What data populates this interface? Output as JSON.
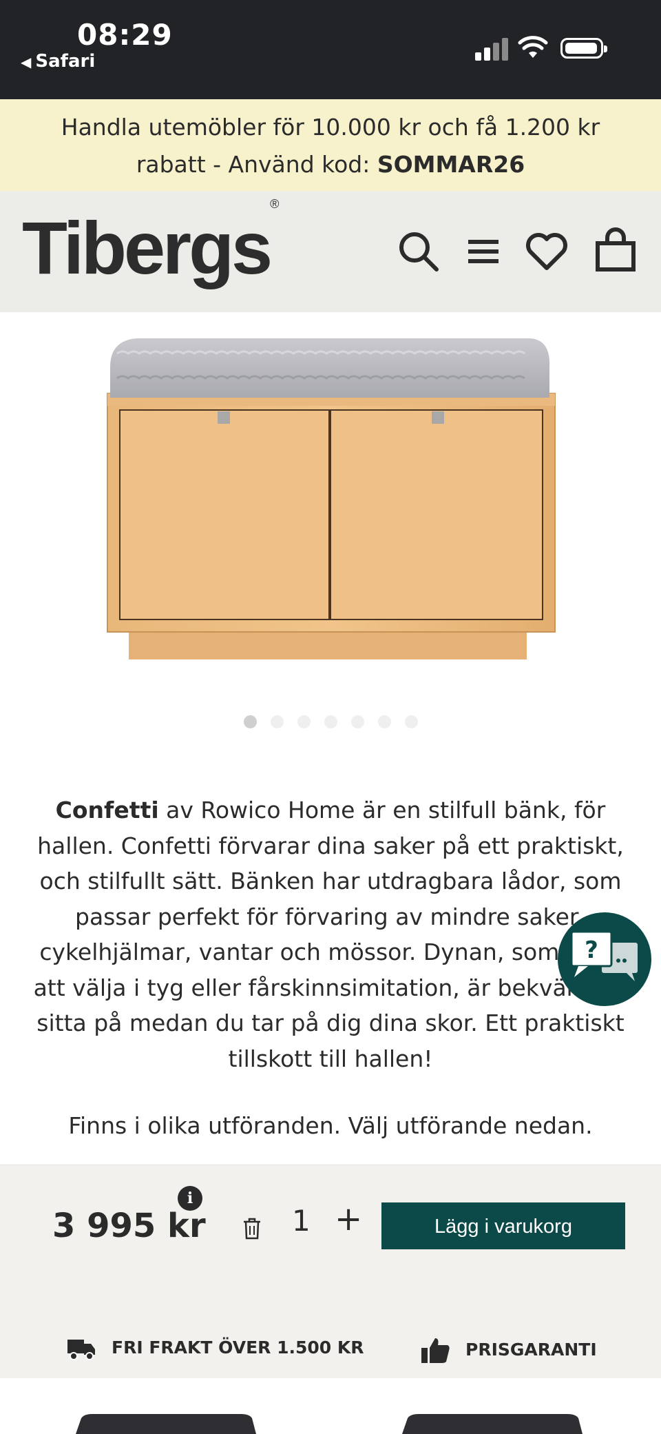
{
  "status_bar": {
    "time": "08:29",
    "back_app": "Safari"
  },
  "promo": {
    "line1": "Handla utemöbler för 10.000 kr och få 1.200 kr",
    "line2_prefix": "rabatt - Använd kod: ",
    "code": "SOMMAR26"
  },
  "header": {
    "logo": "Tibergs",
    "logo_mark": "®",
    "icons": [
      "search-icon",
      "menu-icon",
      "heart-icon",
      "cart-icon"
    ]
  },
  "gallery": {
    "image_name": "confetti-bench",
    "total_images": 7,
    "active_index": 0
  },
  "description": {
    "brand_name": "Confetti",
    "text": " av Rowico Home är en stilfull bänk, för hallen. Confetti förvarar dina saker på ett praktiskt, och stilfullt sätt. Bänken har utdragbara lådor, som passar perfekt för förvaring av mindre saker, cykelhjälmar, vantar och mössor. Dynan, som finns att välja i tyg eller fårskinnsimitation, är bekväm att sitta på medan du tar på dig dina skor. Ett praktiskt tillskott till hallen!",
    "variants_note": "Finns i olika utföranden. Välj utförande nedan."
  },
  "purchase": {
    "price": "3 995 kr",
    "info_glyph": "i",
    "quantity": "1",
    "plus": "+",
    "add_to_cart": "Lägg i varukorg"
  },
  "usps": [
    {
      "icon": "truck-icon",
      "label": "FRI FRAKT ÖVER 1.500 KR"
    },
    {
      "icon": "thumbs-up-icon",
      "label": "PRISGARANTI"
    }
  ],
  "chat": {
    "glyph": "?"
  },
  "colors": {
    "status_bar": "#222326",
    "promo_bg": "#f7f2cc",
    "header_bg": "#ecede8",
    "accent": "#0c4a4a",
    "buybar_bg": "#f3f1ee"
  }
}
